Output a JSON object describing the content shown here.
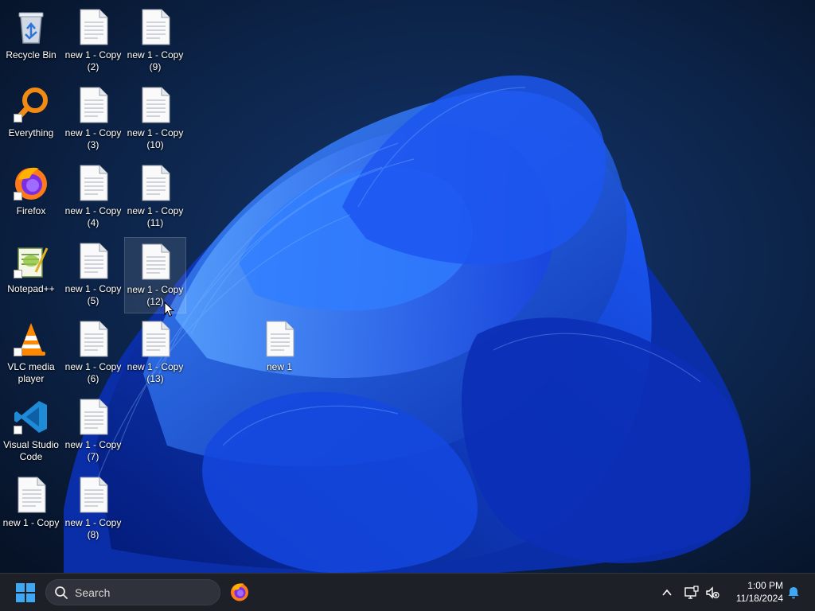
{
  "desktop": {
    "icons": [
      {
        "label": "Recycle Bin",
        "icon": "recycle-bin-icon"
      },
      {
        "label": "new 1 - Copy (2)",
        "icon": "text-file-icon"
      },
      {
        "label": "new 1 - Copy (9)",
        "icon": "text-file-icon"
      },
      {
        "label": "Everything",
        "icon": "everything-search-icon"
      },
      {
        "label": "new 1 - Copy (3)",
        "icon": "text-file-icon"
      },
      {
        "label": "new 1 - Copy (10)",
        "icon": "text-file-icon"
      },
      {
        "label": "Firefox",
        "icon": "firefox-icon"
      },
      {
        "label": "new 1 - Copy (4)",
        "icon": "text-file-icon"
      },
      {
        "label": "new 1 - Copy (11)",
        "icon": "text-file-icon"
      },
      {
        "label": "Notepad++",
        "icon": "notepad-plus-plus-icon"
      },
      {
        "label": "new 1 - Copy (5)",
        "icon": "text-file-icon"
      },
      {
        "label": "new 1 - Copy (12)",
        "icon": "text-file-icon"
      },
      {
        "label": "VLC media player",
        "icon": "vlc-icon"
      },
      {
        "label": "new 1 - Copy (6)",
        "icon": "text-file-icon"
      },
      {
        "label": "new 1 - Copy (13)",
        "icon": "text-file-icon"
      },
      {
        "label": "Visual Studio Code",
        "icon": "vscode-icon"
      },
      {
        "label": "new 1 - Copy (7)",
        "icon": "text-file-icon"
      },
      {
        "label": "new 1 - Copy",
        "icon": "text-file-icon"
      },
      {
        "label": "new 1 - Copy (8)",
        "icon": "text-file-icon"
      },
      {
        "label": "new 1",
        "icon": "text-file-icon"
      }
    ]
  },
  "taskbar": {
    "search_placeholder": "Search",
    "pinned": [
      "firefox-icon"
    ],
    "tray": [
      "chevron-up-icon",
      "network-icon",
      "volume-muted-icon",
      "notification-bell-icon"
    ],
    "clock_time": "1:00 PM",
    "clock_date": "11/18/2024"
  },
  "colors": {
    "accent": "#1f6bff",
    "taskbar_bg": "#1d2027",
    "wallpaper_bg": "#0a1a33"
  }
}
